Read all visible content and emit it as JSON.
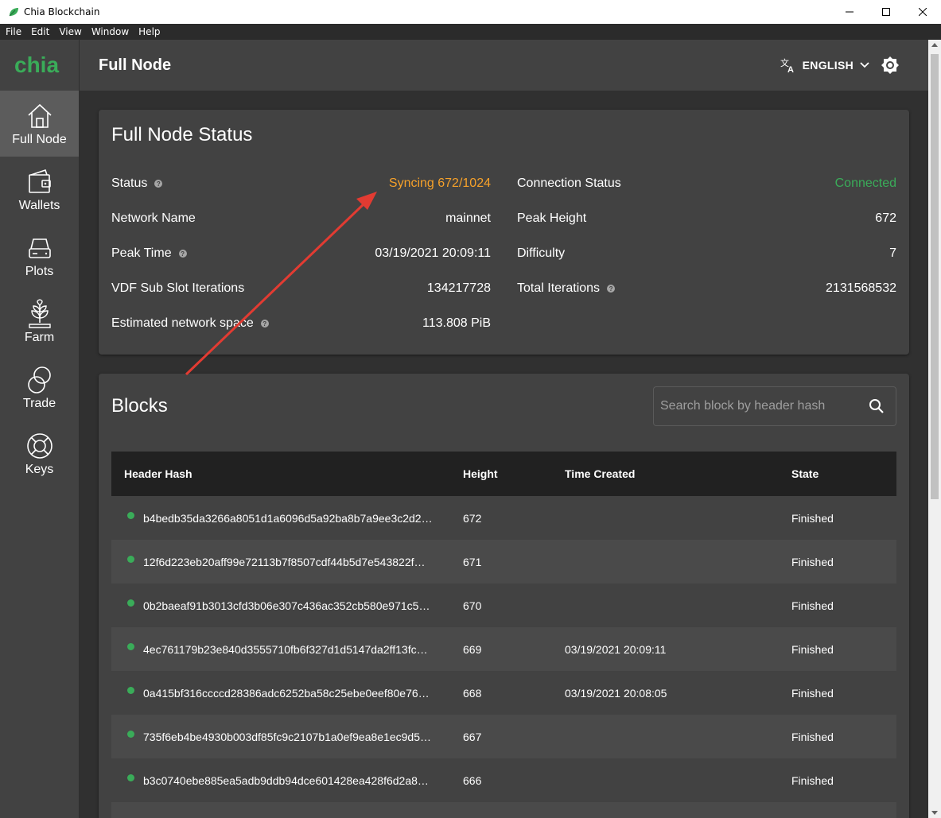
{
  "window": {
    "title": "Chia Blockchain",
    "minimize_icon": "minimize-icon",
    "maximize_icon": "maximize-icon",
    "close_icon": "close-icon"
  },
  "menu": [
    "File",
    "Edit",
    "View",
    "Window",
    "Help"
  ],
  "sidebar": {
    "logo": "chia",
    "items": [
      {
        "label": "Full Node",
        "icon": "home-icon",
        "active": true
      },
      {
        "label": "Wallets",
        "icon": "wallet-icon",
        "active": false
      },
      {
        "label": "Plots",
        "icon": "hard-drive-icon",
        "active": false
      },
      {
        "label": "Farm",
        "icon": "plant-icon",
        "active": false
      },
      {
        "label": "Trade",
        "icon": "trade-circles-icon",
        "active": false
      },
      {
        "label": "Keys",
        "icon": "lifebuoy-icon",
        "active": false
      }
    ]
  },
  "header": {
    "title": "Full Node",
    "language": "ENGLISH",
    "language_icon": "translate-icon",
    "theme_icon": "brightness-icon"
  },
  "status": {
    "title": "Full Node Status",
    "left": [
      {
        "label": "Status",
        "value": "Syncing 672/1024",
        "help": true
      },
      {
        "label": "Network Name",
        "value": "mainnet",
        "help": false
      },
      {
        "label": "Peak Time",
        "value": "03/19/2021 20:09:11",
        "help": true
      },
      {
        "label": "VDF Sub Slot Iterations",
        "value": "134217728",
        "help": false
      },
      {
        "label": "Estimated network space",
        "value": "113.808 PiB",
        "help": true
      }
    ],
    "right": [
      {
        "label": "Connection Status",
        "value": "Connected",
        "help": false
      },
      {
        "label": "Peak Height",
        "value": "672",
        "help": false
      },
      {
        "label": "Difficulty",
        "value": "7",
        "help": false
      },
      {
        "label": "Total Iterations",
        "value": "2131568532",
        "help": true
      }
    ],
    "help_glyph": "?"
  },
  "blocks": {
    "title": "Blocks",
    "search_placeholder": "Search block by header hash",
    "columns": [
      "Header Hash",
      "Height",
      "Time Created",
      "State"
    ],
    "rows": [
      {
        "hash": "b4bedb35da3266a8051d1a6096d5a92ba8b7a9ee3c2d2…",
        "height": "672",
        "time": "",
        "state": "Finished"
      },
      {
        "hash": "12f6d223eb20aff99e72113b7f8507cdf44b5d7e543822f…",
        "height": "671",
        "time": "",
        "state": "Finished"
      },
      {
        "hash": "0b2baeaf91b3013cfd3b06e307c436ac352cb580e971c5…",
        "height": "670",
        "time": "",
        "state": "Finished"
      },
      {
        "hash": "4ec761179b23e840d3555710fb6f327d1d5147da2ff13fc…",
        "height": "669",
        "time": "03/19/2021 20:09:11",
        "state": "Finished"
      },
      {
        "hash": "0a415bf316ccccd28386adc6252ba58c25ebe0eef80e76…",
        "height": "668",
        "time": "03/19/2021 20:08:05",
        "state": "Finished"
      },
      {
        "hash": "735f6eb4be4930b003df85fc9c2107b1a0ef9ea8e1ec9d5…",
        "height": "667",
        "time": "",
        "state": "Finished"
      },
      {
        "hash": "b3c0740ebe885ea5adb9ddb94dce601428ea428f6d2a8…",
        "height": "666",
        "time": "",
        "state": "Finished"
      }
    ]
  },
  "colors": {
    "syncing": "#f6a12a",
    "connected": "#3aac59",
    "brand_green": "#3aac59",
    "annotation_arrow": "#e23b32"
  }
}
